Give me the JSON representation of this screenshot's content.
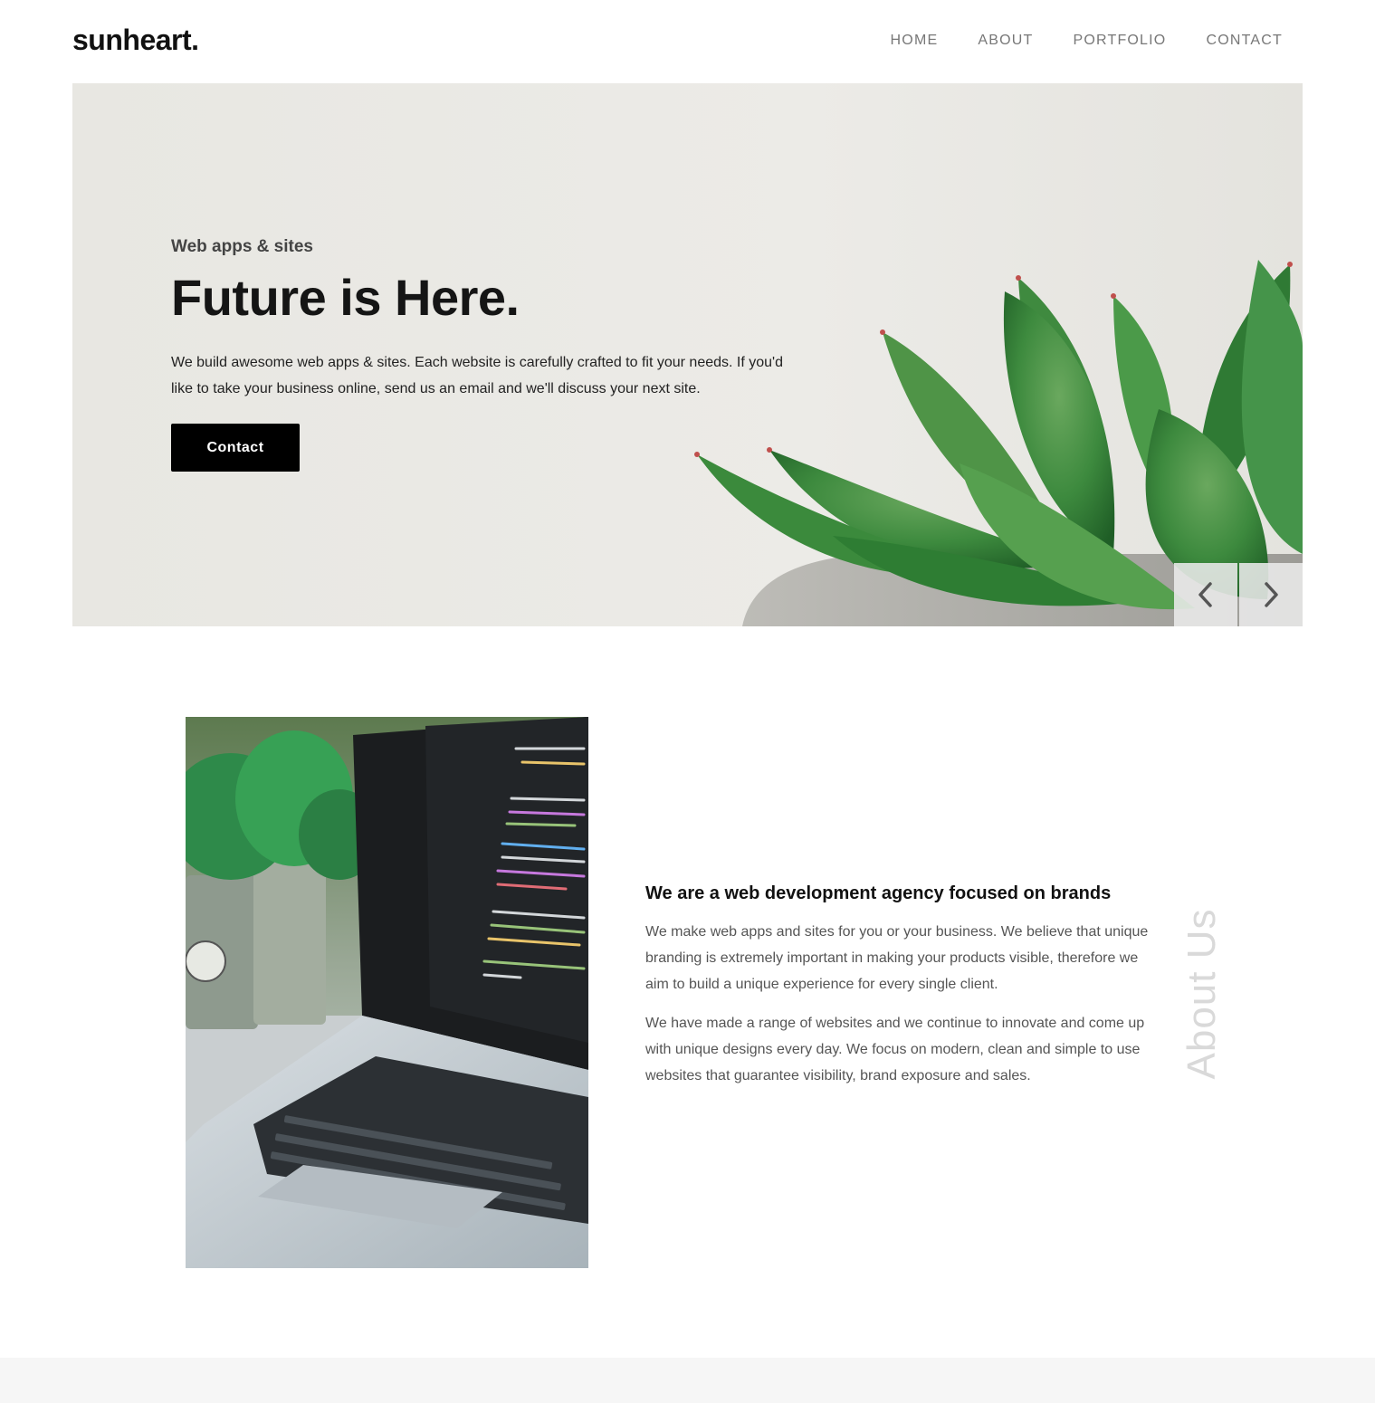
{
  "brand": {
    "name": "sunheart."
  },
  "nav": {
    "items": [
      {
        "label": "HOME"
      },
      {
        "label": "ABOUT"
      },
      {
        "label": "PORTFOLIO"
      },
      {
        "label": "CONTACT"
      }
    ]
  },
  "hero": {
    "kicker": "Web apps & sites",
    "title": "Future is Here.",
    "text": "We build awesome web apps & sites. Each website is carefully crafted to fit your needs. If you'd like to take your business online, send us an email and we'll discuss your next site.",
    "button_label": "Contact",
    "prev_icon": "chevron-left-icon",
    "next_icon": "chevron-right-icon"
  },
  "about": {
    "heading": "We are a web development agency focused on brands",
    "paragraphs": [
      "We make web apps and sites for you or your business. We believe that unique branding is extremely important in making your products visible, therefore we aim to build a unique experience for every single client.",
      "We have made a range of websites and we continue to innovate and come up with unique designs every day. We focus on modern, clean and simple to use websites that guarantee visibility, brand exposure and sales."
    ],
    "vertical_label": "About Us"
  },
  "colors": {
    "accent": "#000000",
    "hero_bg": "#e9e8e4",
    "plant_green": "#3f8a3f",
    "nav_text": "#777777"
  }
}
